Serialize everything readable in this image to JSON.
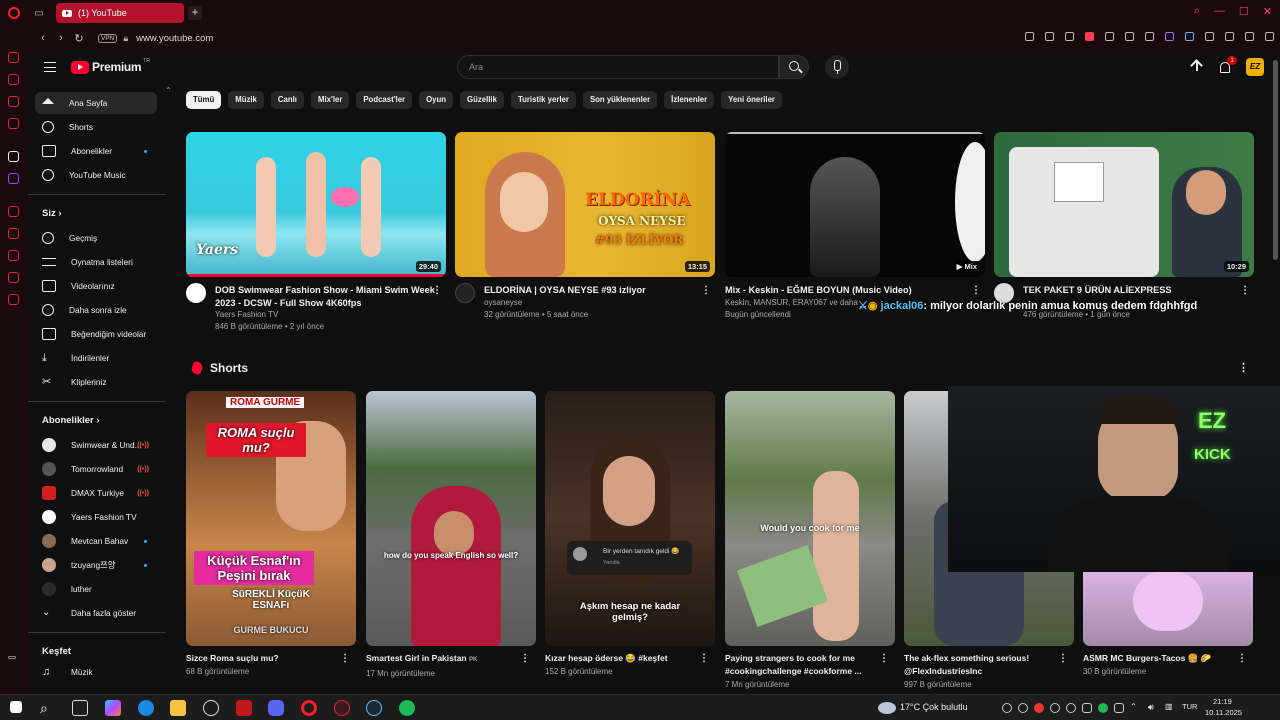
{
  "browser": {
    "tab_title": "(1) YouTube",
    "vpn": "VPN",
    "url": "www.youtube.com"
  },
  "header": {
    "logo": "Premium",
    "logo_region": "TR",
    "search_placeholder": "Ara",
    "notif_count": "1",
    "avatar_text": "EZ"
  },
  "sidebar": {
    "main": [
      {
        "label": "Ana Sayfa",
        "icon": "home-icon"
      },
      {
        "label": "Shorts",
        "icon": "shorts-icon"
      },
      {
        "label": "Abonelikler",
        "icon": "subscriptions-icon"
      },
      {
        "label": "YouTube Music",
        "icon": "music-icon"
      }
    ],
    "you_heading": "Siz",
    "you": [
      {
        "label": "Geçmiş",
        "icon": "history-icon"
      },
      {
        "label": "Oynatma listeleri",
        "icon": "playlists-icon"
      },
      {
        "label": "Videolarınız",
        "icon": "your-videos-icon"
      },
      {
        "label": "Daha sonra izle",
        "icon": "watch-later-icon"
      },
      {
        "label": "Beğendiğim videolar",
        "icon": "liked-icon"
      },
      {
        "label": "İndirilenler",
        "icon": "downloads-icon"
      },
      {
        "label": "Klipleriniz",
        "icon": "clips-icon"
      }
    ],
    "subs_heading": "Abonelikler",
    "subs": [
      {
        "label": "Swimwear & Und...",
        "color": "#e8e8e8"
      },
      {
        "label": "Tomorrowland",
        "color": "#555555"
      },
      {
        "label": "DMAX Turkiye",
        "color": "#d41e1e"
      },
      {
        "label": "Yaers Fashion TV",
        "color": "#ffffff"
      },
      {
        "label": "Mevtcan Bahav",
        "color": "#8a6a50"
      },
      {
        "label": "tzuyang쯔양",
        "color": "#c9a38a"
      },
      {
        "label": "luther",
        "color": "#2a2a2a"
      }
    ],
    "show_more": "Daha fazla göster",
    "explore_heading": "Keşfet",
    "explore": [
      {
        "label": "Müzik",
        "icon": "music-note-icon"
      }
    ]
  },
  "chips": [
    "Tümü",
    "Müzik",
    "Canlı",
    "Mix'ler",
    "Podcast'ler",
    "Oyun",
    "Güzellik",
    "Turistik yerler",
    "Son yüklenenler",
    "İzlenenler",
    "Yeni öneriler"
  ],
  "videos": [
    {
      "title": "DOB Swimwear Fashion Show - Miami Swim Week 2023 - DCSW - Full Show 4K60fps",
      "channel": "Yaers Fashion TV",
      "meta": "846 B görüntüleme • 2 yıl önce",
      "duration": "29:40",
      "watermark": "Yaers"
    },
    {
      "title": "ELDORİNA | OYSA NEYSE #93 izliyor",
      "channel": "oysaneyse",
      "meta": "32 görüntüleme • 5 saat önce",
      "duration": "13:15",
      "overlay1": "ELDORİNA",
      "overlay2": "OYSA NEYSE",
      "overlay3": "#93 İZLİYOR"
    },
    {
      "title": "Mix - Keskin - EĞME BOYUN (Music Video)",
      "channel": "Keskin, MANSUR, ERAY067 ve daha",
      "meta": "Bugün güncellendi",
      "duration": "Mix"
    },
    {
      "title": "TEK PAKET 9 ÜRÜN ALİEXPRESS",
      "channel": "",
      "meta": "476 görüntüleme • 1 gün önce",
      "duration": "10:29"
    }
  ],
  "chat": {
    "name": "jackal06",
    "text": ": milyor dolarlık penin amua komuş dedem fdghhfgd"
  },
  "shorts_heading": "Shorts",
  "shorts": [
    {
      "title": "Sizce Roma suçlu mu?",
      "views": "68 B görüntüleme",
      "cap1": "ROMA GURME",
      "cap2": "ROMA suçlu mu?",
      "cap3": "Küçük Esnaf'ın Peşini bırak",
      "cap4": "SüREKLİ KüçüK ESNAFı",
      "cap5": "GURME BUKUCU"
    },
    {
      "title": "Smartest Girl in Pakistan",
      "flag": "PK",
      "views": "17 Mn görüntüleme",
      "cap1": "how do you speak English so well?"
    },
    {
      "title": "Kızar hesap öderse 😂 #keşfet",
      "views": "152 B görüntüleme",
      "cap1": "Bir yerden tanıdık geldi 😂",
      "cap1b": "Yanıtla",
      "cap2": "Aşkım hesap ne kadar gelmiş?"
    },
    {
      "title": "Paying strangers to cook for me #cookingchallenge #cookforme ...",
      "views": "7 Mn görüntüleme",
      "cap1": "Would you cook for me"
    },
    {
      "title": "The ak-flex something serious! @FlexIndustriesInc",
      "views": "997 B görüntüleme"
    },
    {
      "title": "ASMR MC Burgers-Tacos 🍔 🌮",
      "views": "30 B görüntüleme"
    }
  ],
  "webcam": {
    "sign1": "EZ",
    "sign2": "KICK"
  },
  "taskbar": {
    "weather": "17°C  Çok bulutlu",
    "lang": "TUR",
    "time": "21:19",
    "date": "10.11.2025"
  }
}
